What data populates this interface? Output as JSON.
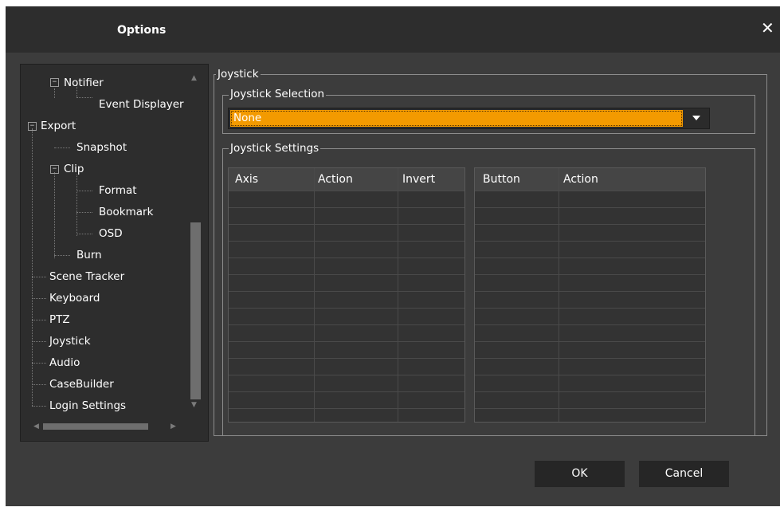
{
  "window": {
    "title": "Options",
    "close_glyph": "✕"
  },
  "tree": {
    "items": [
      {
        "label": "Notifier",
        "expander": "−"
      },
      {
        "label": "Event Displayer"
      },
      {
        "label": "Export",
        "expander": "−"
      },
      {
        "label": "Snapshot"
      },
      {
        "label": "Clip",
        "expander": "−"
      },
      {
        "label": "Format"
      },
      {
        "label": "Bookmark"
      },
      {
        "label": "OSD"
      },
      {
        "label": "Burn"
      },
      {
        "label": "Scene Tracker"
      },
      {
        "label": "Keyboard"
      },
      {
        "label": "PTZ"
      },
      {
        "label": "Joystick"
      },
      {
        "label": "Audio"
      },
      {
        "label": "CaseBuilder"
      },
      {
        "label": "Login Settings"
      }
    ],
    "scroll_glyphs": {
      "up": "▲",
      "down": "▼",
      "left": "◀",
      "right": "▶"
    }
  },
  "joystick": {
    "group_title": "Joystick",
    "selection": {
      "title": "Joystick Selection",
      "value": "None"
    },
    "settings": {
      "title": "Joystick Settings",
      "axis_table": {
        "columns": [
          "Axis",
          "Action",
          "Invert"
        ],
        "rows": []
      },
      "button_table": {
        "columns": [
          "Button",
          "Action"
        ],
        "rows": []
      }
    }
  },
  "buttons": {
    "ok": "OK",
    "cancel": "Cancel"
  },
  "colors": {
    "accent": "#f39a00",
    "dialog_bg": "#3c3c3c",
    "titlebar_bg": "#2d2d2d"
  }
}
